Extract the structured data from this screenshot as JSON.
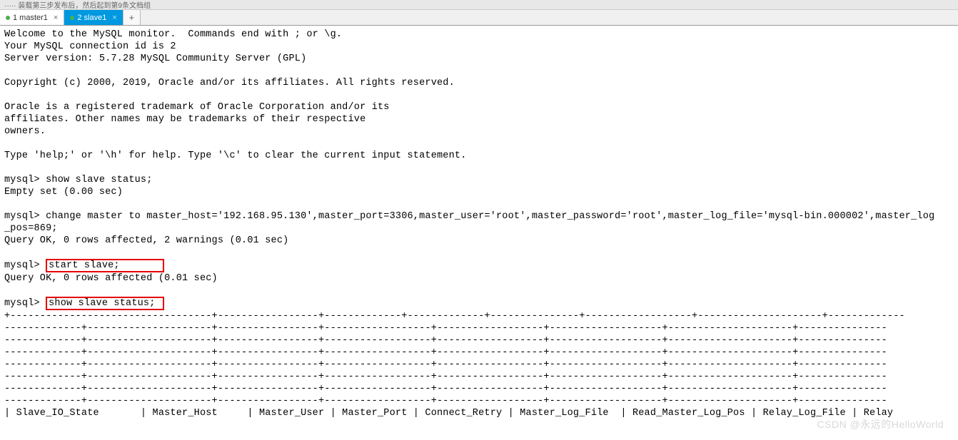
{
  "topbar": {
    "hint": "····· 装载第三步发布后，然后起到第9条文档组"
  },
  "tabs": {
    "items": [
      {
        "label": "1 master1",
        "active": false
      },
      {
        "label": "2 slave1",
        "active": true
      }
    ],
    "add_label": "+"
  },
  "terminal": {
    "line01": "Welcome to the MySQL monitor.  Commands end with ; or \\g.",
    "line02": "Your MySQL connection id is 2",
    "line03": "Server version: 5.7.28 MySQL Community Server (GPL)",
    "line04": "",
    "line05": "Copyright (c) 2000, 2019, Oracle and/or its affiliates. All rights reserved.",
    "line06": "",
    "line07": "Oracle is a registered trademark of Oracle Corporation and/or its",
    "line08": "affiliates. Other names may be trademarks of their respective",
    "line09": "owners.",
    "line10": "",
    "line11": "Type 'help;' or '\\h' for help. Type '\\c' to clear the current input statement.",
    "line12": "",
    "line13": "mysql> show slave status;",
    "line14": "Empty set (0.00 sec)",
    "line15": "",
    "line16": "mysql> change master to master_host='192.168.95.130',master_port=3306,master_user='root',master_password='root',master_log_file='mysql-bin.000002',master_log",
    "line17": "_pos=869;",
    "line18": "Query OK, 0 rows affected, 2 warnings (0.01 sec)",
    "line19": "",
    "line20_prompt": "mysql> ",
    "line20_cmd": "start slave;       ",
    "line21": "Query OK, 0 rows affected (0.01 sec)",
    "line22": "",
    "line23_prompt": "mysql> ",
    "line23_cmd": "show slave status; ",
    "sep1": "+----------------------------------+-----------------+-------------+-------------+---------------+------------------+---------------------+-------------",
    "sep_dash": "-------------+---------------------+-----------------+------------------+------------------+-------------------+---------------------+---------------",
    "header_row": "| Slave_IO_State       | Master_Host     | Master_User | Master_Port | Connect_Retry | Master_Log_File  | Read_Master_Log_Pos | Relay_Log_File | Relay"
  },
  "watermark": "CSDN @永远的HelloWorld"
}
